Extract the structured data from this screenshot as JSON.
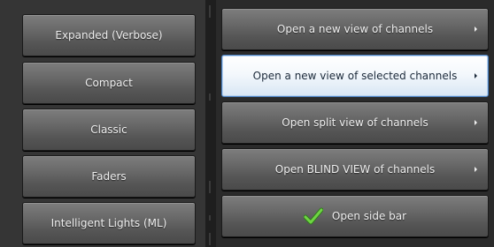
{
  "view_modes": [
    {
      "label": "Expanded (Verbose)"
    },
    {
      "label": "Compact"
    },
    {
      "label": "Classic"
    },
    {
      "label": "Faders"
    },
    {
      "label": "Intelligent Lights (ML)"
    }
  ],
  "actions": [
    {
      "label": "Open a new view of channels",
      "has_submenu": true,
      "selected": false
    },
    {
      "label": "Open a new view of selected channels",
      "has_submenu": true,
      "selected": true
    },
    {
      "label": "Open split view of channels",
      "has_submenu": true,
      "selected": false
    },
    {
      "label": "Open BLIND VIEW of channels",
      "has_submenu": true,
      "selected": false
    },
    {
      "label": "Open side bar",
      "icon": "checkmark-icon",
      "selected": false
    }
  ],
  "colors": {
    "button_gray": "#6a6a6a",
    "selected_bg": "#f4f8fc",
    "selected_border": "#4a7fc0",
    "check_green": "#5cc23a"
  }
}
